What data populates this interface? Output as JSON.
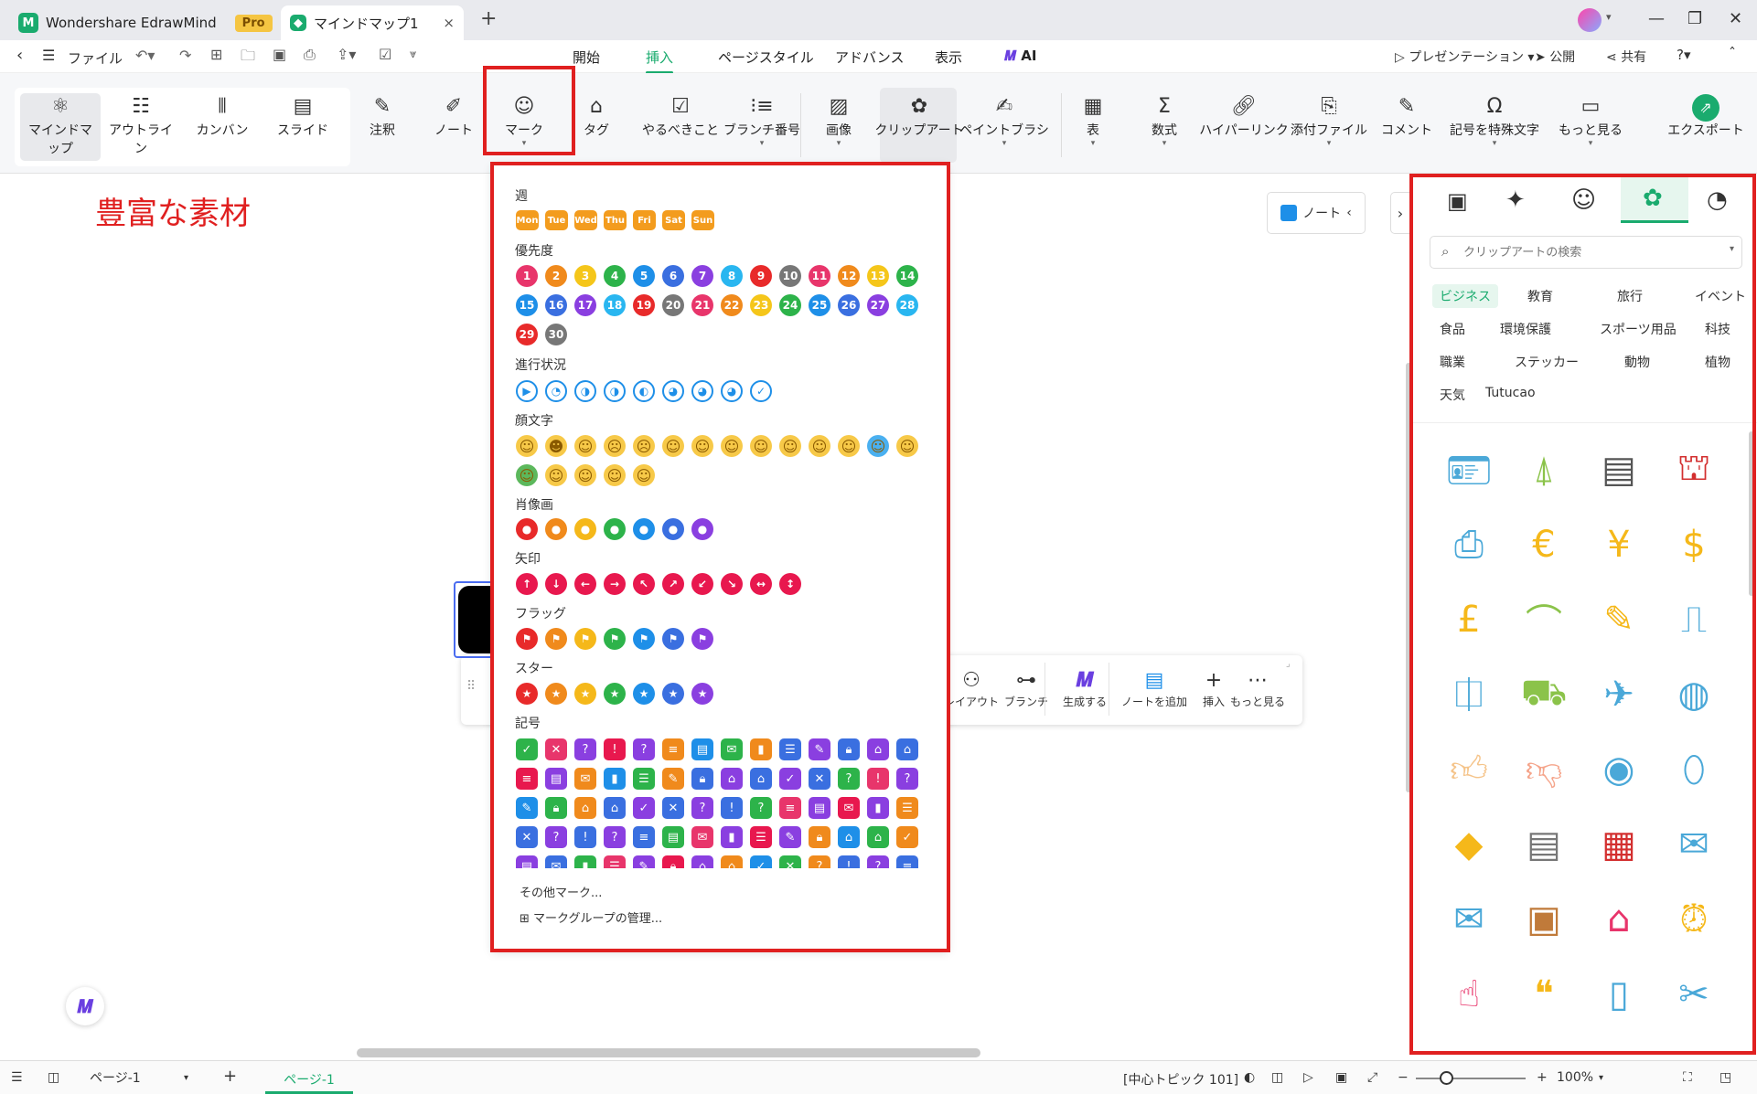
{
  "titlebar": {
    "app_tab": "Wondershare EdrawMind",
    "pro_badge": "Pro",
    "doc_tab": "マインドマップ1",
    "close": "×",
    "new_tab": "+"
  },
  "menubar": {
    "file": "ファイル",
    "items": [
      "開始",
      "挿入",
      "ページスタイル",
      "アドバンス",
      "表示",
      "AI"
    ],
    "right": [
      "プレゼンテーション",
      "公開",
      "共有"
    ]
  },
  "ribbon": {
    "map_modes": [
      {
        "label": "マインドマップ",
        "icon": "mindmap-icon"
      },
      {
        "label": "アウトライン",
        "icon": "outline-icon"
      },
      {
        "label": "カンバン",
        "icon": "kanban-icon"
      },
      {
        "label": "スライド",
        "icon": "slide-icon"
      }
    ],
    "tools": [
      {
        "label": "注釈",
        "icon": "annotation-icon"
      },
      {
        "label": "ノート",
        "icon": "note-icon"
      },
      {
        "label": "マーク",
        "icon": "smiley-icon"
      },
      {
        "label": "タグ",
        "icon": "tag-icon"
      },
      {
        "label": "やるべきこと",
        "icon": "todo-icon"
      },
      {
        "label": "ブランチ番号",
        "icon": "numbering-icon"
      },
      {
        "label": "画像",
        "icon": "image-icon"
      },
      {
        "label": "クリップアート",
        "icon": "clipart-icon"
      },
      {
        "label": "ペイントブラシ",
        "icon": "brush-icon"
      },
      {
        "label": "表",
        "icon": "table-icon"
      },
      {
        "label": "数式",
        "icon": "sigma-icon"
      },
      {
        "label": "ハイパーリンク",
        "icon": "link-icon"
      },
      {
        "label": "添付ファイル",
        "icon": "paperclip-icon"
      },
      {
        "label": "コメント",
        "icon": "comment-icon"
      },
      {
        "label": "記号を特殊文字",
        "icon": "omega-icon"
      },
      {
        "label": "もっと見る",
        "icon": "more-icon"
      }
    ],
    "export": "エクスポート"
  },
  "canvas": {
    "heading": "豊富な素材",
    "note_button": "ノート",
    "float_toolbar": [
      "レイアウト",
      "ブランチ",
      "生成する",
      "ノートを追加",
      "挿入",
      "もっと見る"
    ]
  },
  "marks_panel": {
    "sections": {
      "week": "週",
      "priority": "優先度",
      "progress": "進行状況",
      "emoji": "顔文字",
      "portrait": "肖像画",
      "arrow": "矢印",
      "flag": "フラッグ",
      "star": "スター",
      "symbol": "記号"
    },
    "days": [
      "Mon",
      "Tue",
      "Wed",
      "Thu",
      "Fri",
      "Sat",
      "Sun"
    ],
    "priority_numbers": [
      "1",
      "2",
      "3",
      "4",
      "5",
      "6",
      "7",
      "8",
      "9",
      "10",
      "11",
      "12",
      "13",
      "14",
      "15",
      "16",
      "17",
      "18",
      "19",
      "20",
      "21",
      "22",
      "23",
      "24",
      "25",
      "26",
      "27",
      "28",
      "29",
      "30"
    ],
    "priority_colors": [
      "#e8356b",
      "#f08a1c",
      "#f5c61a",
      "#2db34a",
      "#1e8fe8",
      "#3a6fe0",
      "#8a3fe0",
      "#29b6f0",
      "#e82a2a",
      "#777777",
      "#e8356b",
      "#f08a1c",
      "#f5c61a",
      "#2db34a",
      "#1e8fe8",
      "#3a6fe0",
      "#8a3fe0",
      "#29b6f0",
      "#e82a2a",
      "#777777",
      "#e8356b",
      "#f08a1c",
      "#f5c61a",
      "#2db34a",
      "#1e8fe8",
      "#3a6fe0",
      "#8a3fe0",
      "#29b6f0",
      "#e82a2a",
      "#777777"
    ],
    "footer": {
      "more_marks": "その他マーク...",
      "manage_groups": "マークグループの管理..."
    }
  },
  "right_panel": {
    "search_placeholder": "クリップアートの検索",
    "categories": [
      "ビジネス",
      "教育",
      "旅行",
      "イベント",
      "食品",
      "環境保護",
      "スポーツ用品",
      "科技",
      "職業",
      "ステッカー",
      "動物",
      "植物",
      "天気",
      "Tutucao"
    ],
    "selected_category": "ビジネス"
  },
  "statusbar": {
    "page_select": "ページ-1",
    "page_tab": "ページ-1",
    "center_topic": "[中心トピック 101]",
    "zoom": "100%"
  },
  "colors": {
    "accent": "#1aab6e",
    "highlight": "#e02020",
    "day": "#f39c1e"
  }
}
